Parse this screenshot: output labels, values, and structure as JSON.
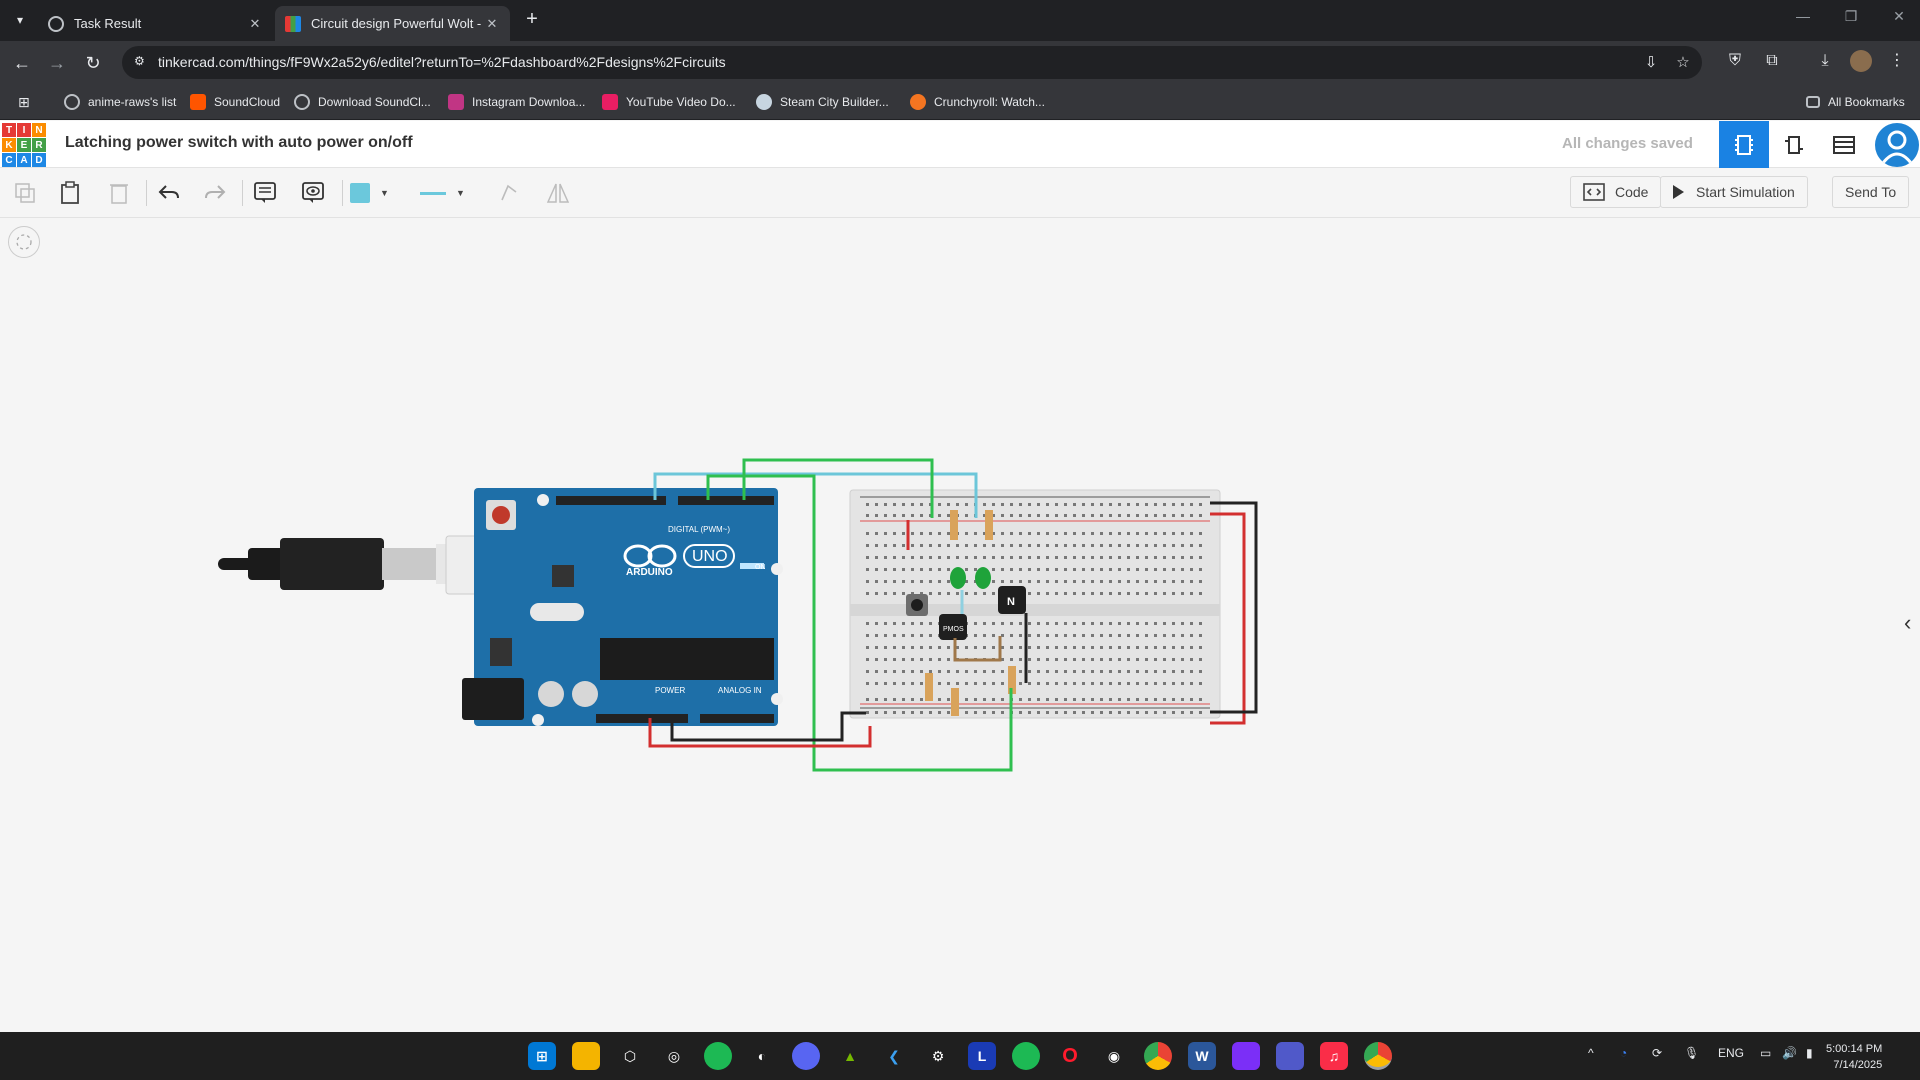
{
  "browser": {
    "tabs": [
      {
        "title": "Task Result",
        "active": false
      },
      {
        "title": "Circuit design Powerful Wolt - T",
        "active": true
      }
    ],
    "url": "tinkercad.com/things/fF9Wx2a52y6/editel?returnTo=%2Fdashboard%2Fdesigns%2Fcircuits",
    "bookmarks": [
      "anime-raws's list",
      "SoundCloud",
      "Download SoundCl...",
      "Instagram Downloa...",
      "YouTube Video Do...",
      "Steam City Builder...",
      "Crunchyroll: Watch..."
    ],
    "all_bookmarks_label": "All Bookmarks"
  },
  "app": {
    "logo_letters": [
      "T",
      "I",
      "N",
      "K",
      "E",
      "R",
      "C",
      "A",
      "D"
    ],
    "design_title": "Latching power switch with auto power on/off",
    "save_status": "All changes saved",
    "toolbar": {
      "code_label": "Code",
      "simulate_label": "Start Simulation",
      "send_to_label": "Send To"
    }
  },
  "circuit": {
    "arduino_brand": "ARDUINO",
    "arduino_model": "UNO",
    "digital_label": "DIGITAL (PWM~)",
    "power_label": "POWER",
    "analog_label": "ANALOG IN",
    "on_label": "ON",
    "pmos_label": "PMOS",
    "nmos_label": "N"
  },
  "taskbar": {
    "language": "ENG",
    "time": "5:00:14 PM",
    "date": "7/14/2025"
  },
  "colors": {
    "arduino_blue": "#1e6fa8",
    "tinkercad_accent": "#1a82e3",
    "wire_green": "#2fbf4f",
    "wire_cyan": "#6cc6d9",
    "wire_red": "#d32f2f",
    "wire_black": "#222222"
  }
}
